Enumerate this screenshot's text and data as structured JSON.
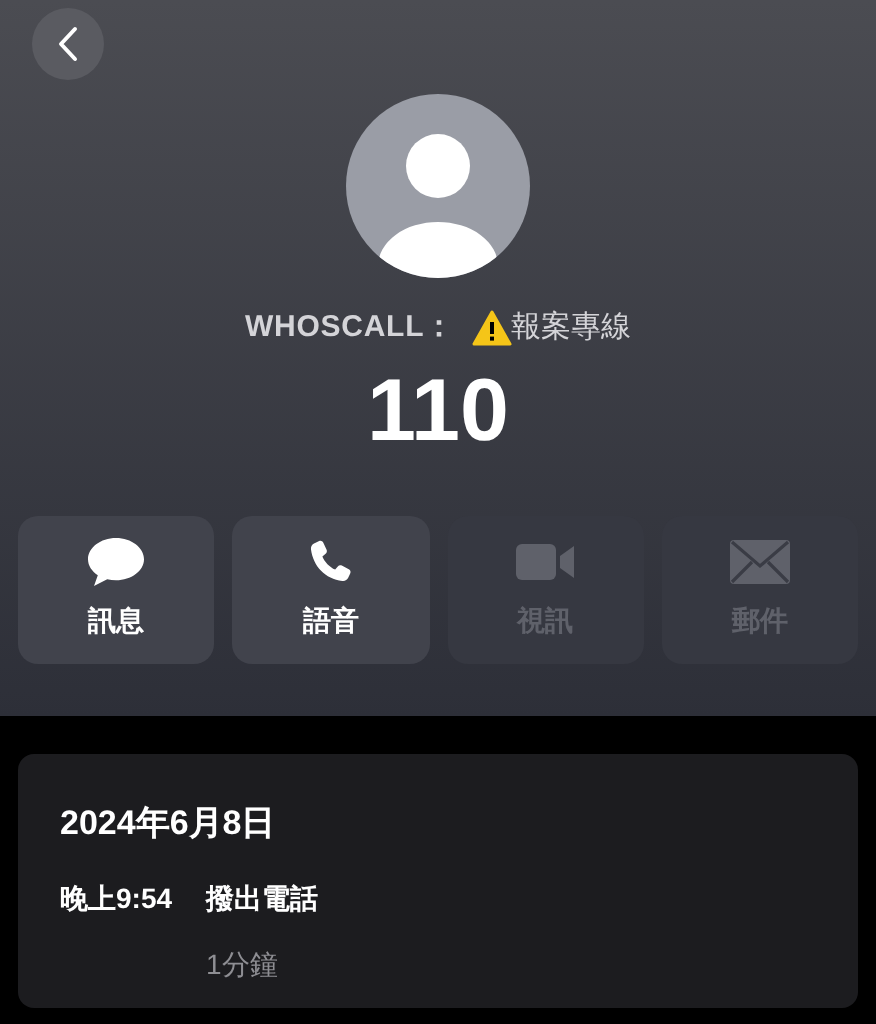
{
  "contact": {
    "caller_source": "WHOSCALL：",
    "caller_label": "報案專線",
    "number": "110"
  },
  "actions": [
    {
      "kind": "message",
      "label": "訊息",
      "disabled": false
    },
    {
      "kind": "phone",
      "label": "語音",
      "disabled": false
    },
    {
      "kind": "video",
      "label": "視訊",
      "disabled": true
    },
    {
      "kind": "mail",
      "label": "郵件",
      "disabled": true
    }
  ],
  "call_log": {
    "date": "2024年6月8日",
    "entries": [
      {
        "time": "晚上9:54",
        "type": "撥出電話",
        "duration": "1分鐘"
      }
    ]
  }
}
